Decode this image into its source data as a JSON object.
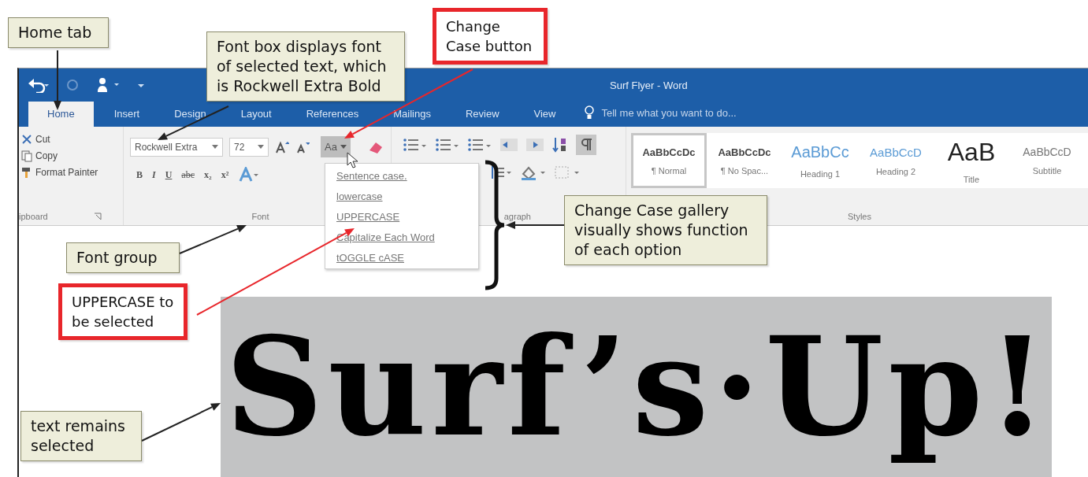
{
  "window": {
    "title": "Surf Flyer - Word"
  },
  "tabs": [
    {
      "label": "Home",
      "selected": true
    },
    {
      "label": "Insert",
      "selected": false
    },
    {
      "label": "Design",
      "selected": false
    },
    {
      "label": "Layout",
      "selected": false
    },
    {
      "label": "References",
      "selected": false
    },
    {
      "label": "Mailings",
      "selected": false
    },
    {
      "label": "Review",
      "selected": false
    },
    {
      "label": "View",
      "selected": false
    }
  ],
  "tell_me": {
    "placeholder": "Tell me what you want to do..."
  },
  "clipboard": {
    "items": [
      "Cut",
      "Copy",
      "Format Painter"
    ],
    "group_label": "ipboard"
  },
  "font_group": {
    "font_name": "Rockwell Extra",
    "font_size": "72",
    "format_buttons": [
      "B",
      "I",
      "U",
      "abc",
      "x₂",
      "x²"
    ],
    "change_case_button": {
      "label": "Aa",
      "open": true
    },
    "group_label": "Font"
  },
  "paragraph_group": {
    "group_label": "agraph"
  },
  "styles": {
    "items": [
      {
        "preview": "AaBbCcDc",
        "name": "¶ Normal",
        "selected": true
      },
      {
        "preview": "AaBbCcDc",
        "name": "¶ No Spac...",
        "selected": false
      },
      {
        "preview": "AaBbCc",
        "name": "Heading 1",
        "selected": false
      },
      {
        "preview": "AaBbCcD",
        "name": "Heading 2",
        "selected": false
      },
      {
        "preview": "AaB",
        "name": "Title",
        "selected": false
      },
      {
        "preview": "AaBbCcD",
        "name": "Subtitle",
        "selected": false
      }
    ],
    "group_label": "Styles"
  },
  "change_case_menu": [
    "Sentence case.",
    "lowercase",
    "UPPERCASE",
    "Capitalize Each Word",
    "tOGGLE cASE"
  ],
  "document": {
    "text": "Surf’s·Up!",
    "selected": true
  },
  "callouts": [
    {
      "text": "Home tab",
      "kind": "note"
    },
    {
      "text": "Font box displays font of selected text, which is Rockwell Extra Bold",
      "kind": "note"
    },
    {
      "text": "Change Case button",
      "kind": "highlight"
    },
    {
      "text": "Change Case gallery visually shows function of each option",
      "kind": "note"
    },
    {
      "text": "Font group",
      "kind": "note"
    },
    {
      "text": "UPPERCASE to be selected",
      "kind": "highlight"
    },
    {
      "text": "text remains selected",
      "kind": "note"
    }
  ]
}
